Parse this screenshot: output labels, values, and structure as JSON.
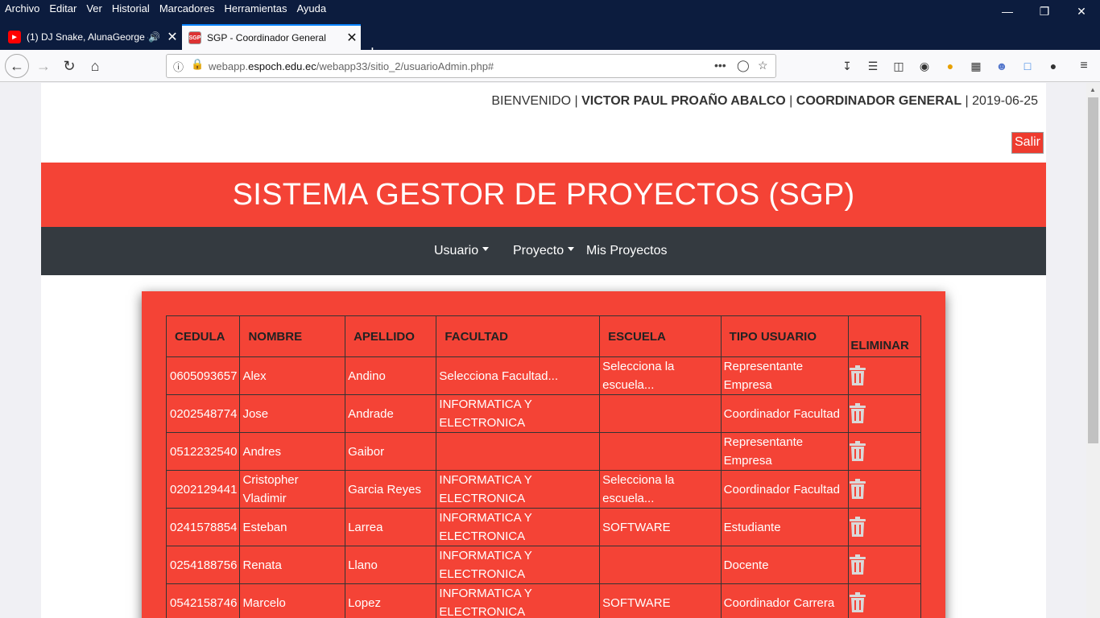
{
  "browser": {
    "menus": [
      "Archivo",
      "Editar",
      "Ver",
      "Historial",
      "Marcadores",
      "Herramientas",
      "Ayuda"
    ],
    "tabs": [
      {
        "title": "(1) DJ Snake, AlunaGeorge -",
        "favicon": "youtube-icon"
      },
      {
        "title": "SGP - Coordinador General",
        "favicon": "SGP"
      }
    ],
    "url_prefix": "webapp.",
    "url_domain": "espoch.edu.ec",
    "url_path": "/webapp33/sitio_2/usuarioAdmin.php#"
  },
  "header": {
    "welcome_label": "BIENVENIDO",
    "user_name": "VICTOR PAUL PROAÑO ABALCO",
    "role": "COORDINADOR GENERAL",
    "date": "2019-06-25",
    "logout_label": "Salir"
  },
  "banner": {
    "title": "SISTEMA GESTOR DE PROYECTOS (SGP)"
  },
  "nav": {
    "usuario": "Usuario",
    "proyecto": "Proyecto",
    "mis_proyectos": "Mis Proyectos"
  },
  "table": {
    "headers": [
      "CEDULA",
      "NOMBRE",
      "APELLIDO",
      "FACULTAD",
      "ESCUELA",
      "TIPO USUARIO",
      "ELIMINAR"
    ],
    "rows": [
      {
        "cedula": "0605093657",
        "nombre": "Alex",
        "apellido": "Andino",
        "facultad": "Selecciona Facultad...",
        "escuela": "Selecciona la escuela...",
        "tipo": "Representante Empresa"
      },
      {
        "cedula": "0202548774",
        "nombre": "Jose",
        "apellido": "Andrade",
        "facultad": "INFORMATICA Y ELECTRONICA",
        "escuela": "",
        "tipo": "Coordinador Facultad"
      },
      {
        "cedula": "0512232540",
        "nombre": "Andres",
        "apellido": "Gaibor",
        "facultad": "",
        "escuela": "",
        "tipo": "Representante Empresa"
      },
      {
        "cedula": "0202129441",
        "nombre": "Cristopher Vladimir",
        "apellido": "Garcia Reyes",
        "facultad": "INFORMATICA Y ELECTRONICA",
        "escuela": "Selecciona la escuela...",
        "tipo": "Coordinador Facultad"
      },
      {
        "cedula": "0241578854",
        "nombre": "Esteban",
        "apellido": "Larrea",
        "facultad": "INFORMATICA Y ELECTRONICA",
        "escuela": "SOFTWARE",
        "tipo": "Estudiante"
      },
      {
        "cedula": "0254188756",
        "nombre": "Renata",
        "apellido": "Llano",
        "facultad": "INFORMATICA Y ELECTRONICA",
        "escuela": "",
        "tipo": "Docente"
      },
      {
        "cedula": "0542158746",
        "nombre": "Marcelo",
        "apellido": "Lopez",
        "facultad": "INFORMATICA Y ELECTRONICA",
        "escuela": "SOFTWARE",
        "tipo": "Coordinador Carrera"
      }
    ]
  },
  "colors": {
    "accent": "#f44336",
    "nav_bg": "#343a40",
    "browser_chrome": "#0c1c3e"
  }
}
